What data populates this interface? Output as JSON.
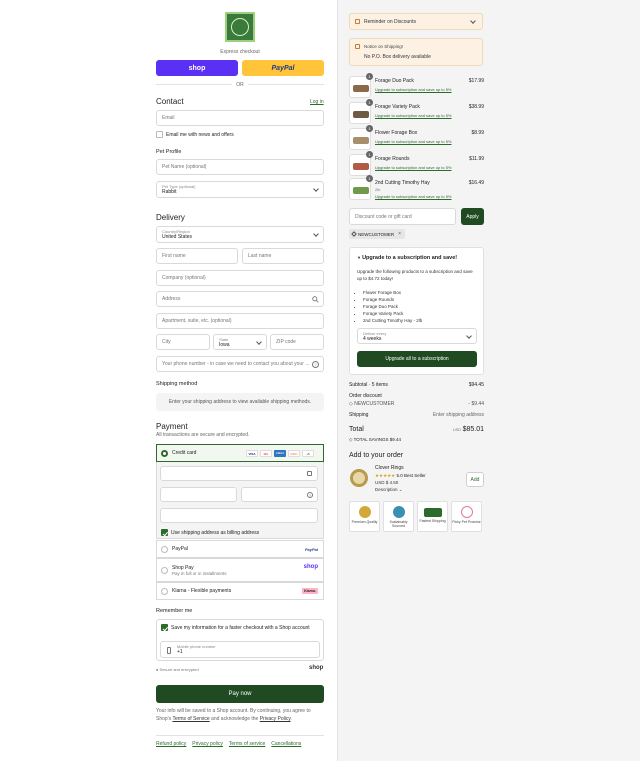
{
  "header": {
    "express_checkout": "Express checkout",
    "or": "OR"
  },
  "express": {
    "shop_label": "shop",
    "paypal_label": "PayPal"
  },
  "contact": {
    "title": "Contact",
    "login_link": "Log in",
    "email_placeholder": "Email",
    "email_news_label": "Email me with news and offers"
  },
  "pet_profile": {
    "title": "Pet Profile",
    "pet_name_placeholder": "Pet Name (optional)",
    "pet_type_label": "Pet Type (optional)",
    "pet_type_value": "Rabbit"
  },
  "delivery": {
    "title": "Delivery",
    "country_label": "Country/Region",
    "country_value": "United States",
    "first_name": "First name",
    "last_name": "Last name",
    "company": "Company (optional)",
    "address": "Address",
    "apartment": "Apartment, suite, etc. (optional)",
    "city": "City",
    "state_label": "State",
    "state_value": "Iowa",
    "zip": "ZIP code",
    "phone": "Your phone number - in case we need to contact you about your ..."
  },
  "shipping": {
    "title": "Shipping method",
    "message": "Enter your shipping address to view available shipping methods."
  },
  "payment": {
    "title": "Payment",
    "subtitle": "All transactions are secure and encrypted.",
    "credit_card": "Credit card",
    "card_brands": [
      "VISA",
      "MC",
      "AMEX",
      "DISC"
    ],
    "more_brands": "+5",
    "billing_same": "Use shipping address as billing address",
    "paypal": "PayPal",
    "shop_pay": "Shop Pay",
    "shop_pay_sub": "Pay in full or in installments",
    "shop_pay_logo": "shop",
    "klarna": "Klarna - Flexible payments",
    "klarna_logo": "Klarna."
  },
  "remember": {
    "title": "Remember me",
    "save_label": "Save my information for a faster checkout with a Shop account",
    "phone_label": "Mobile phone number",
    "phone_value": "+1",
    "secure": "Secure and encrypted",
    "shop_logo": "shop"
  },
  "pay_now": "Pay now",
  "legal": {
    "line1": "Your info will be saved to a Shop account. By continuing, you agree to",
    "line2_a": "Shop's ",
    "terms": "Terms of Service",
    "line2_b": " and acknowledge the ",
    "privacy": "Privacy Policy",
    "line2_c": "."
  },
  "footer": [
    "Refund policy",
    "Privacy policy",
    "Terms of service",
    "Cancellations"
  ],
  "summary": {
    "reminder": "Reminder on Discounts",
    "notice_title": "Notice on Shipping!",
    "notice_body": "No P.O. Box delivery available",
    "items": [
      {
        "qty": "1",
        "name": "Forage Duo Pack",
        "sub": "Upgrade to subscription and save up to 5%",
        "price": "$17.99",
        "color": "#8a6a4a"
      },
      {
        "qty": "1",
        "name": "Forage Variety Pack",
        "sub": "Upgrade to subscription and save up to 5%",
        "price": "$38.99",
        "color": "#6f5b44"
      },
      {
        "qty": "1",
        "name": "Flower Forage Box",
        "sub": "Upgrade to subscription and save up to 5%",
        "price": "$8.99",
        "color": "#a98e6c"
      },
      {
        "qty": "1",
        "name": "Forage Rounds",
        "sub": "Upgrade to subscription and save up to 5%",
        "price": "$11.99",
        "color": "#b35a45"
      },
      {
        "qty": "1",
        "name": "2nd Cutting Timothy Hay",
        "variant": "2lb",
        "sub": "Upgrade to subscription and save up to 5%",
        "price": "$16.49",
        "color": "#6f9a4a"
      }
    ],
    "discount_placeholder": "Discount code or gift card",
    "apply": "Apply",
    "tag": "NEWCUSTOMER",
    "upgrade": {
      "title": "Upgrade to a subscription and save!",
      "body": "Upgrade the following products to a subscription and save up to $4.72 today!",
      "products": [
        "Flower Forage Box",
        "Forage Rounds",
        "Forage Duo Pack",
        "Forage Variety Pack",
        "2nd Cutting Timothy Hay - 2lb"
      ],
      "deliver_label": "Deliver every",
      "deliver_value": "4 weeks",
      "button": "Upgrade all to a subscription"
    },
    "subtotal_label": "Subtotal · 5 items",
    "subtotal_value": "$94.45",
    "order_discount": "Order discount",
    "discount_code": "NEWCUSTOMER",
    "discount_value": "- $9.44",
    "shipping_label": "Shipping",
    "shipping_value": "Enter shipping address",
    "total_label": "Total",
    "currency": "USD",
    "total_value": "$85.01",
    "savings_label": "TOTAL SAVINGS",
    "savings_value": "$9.44"
  },
  "addon": {
    "title": "Add to your order",
    "name": "Clover Rings",
    "rating": "5.0 Best Seller",
    "price": "USD $ 4.50",
    "description": "Description",
    "add": "Add"
  },
  "badges": [
    "Premium Quality",
    "Sustainably Sourced",
    "Fastest Shipping",
    "Picky Pet Promise"
  ],
  "colors": {
    "brand_green": "#1f4a22",
    "link_green": "#2d6b2d",
    "shop_purple": "#5a31f4",
    "paypal_yellow": "#ffc439"
  }
}
